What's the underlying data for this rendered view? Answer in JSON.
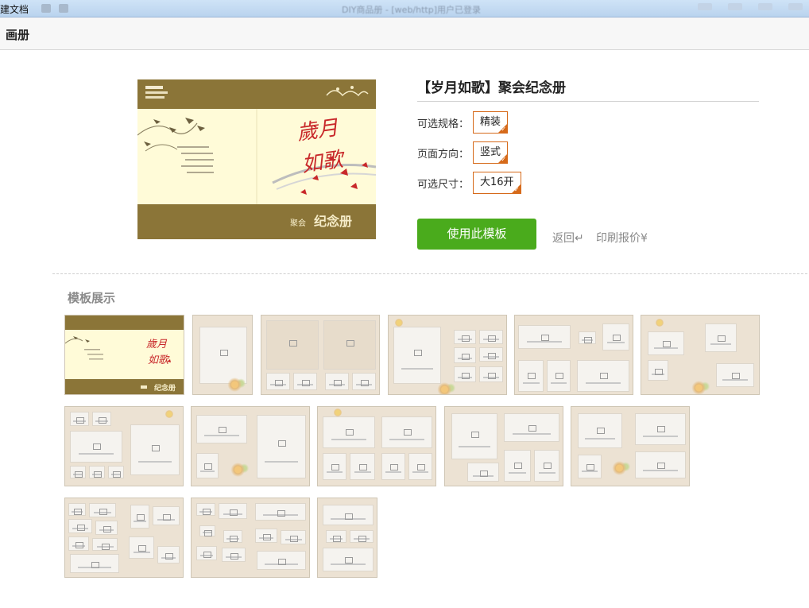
{
  "titlebar": {
    "app_name": "建文档",
    "doc_title": "DIY商品册 - [web/http]用户已登录"
  },
  "appbar": {
    "title": "画册"
  },
  "product": {
    "title": "【岁月如歌】聚会纪念册",
    "options": [
      {
        "label": "可选规格：",
        "value": "精装"
      },
      {
        "label": "页面方向：",
        "value": "竖式"
      },
      {
        "label": "可选尺寸：",
        "value": "大16开"
      }
    ],
    "use_template_label": "使用此模板",
    "back_label": "返回↵",
    "quote_label": "印刷报价¥"
  },
  "cover": {
    "calligraphy": "歲月如歌",
    "subtitle": "聚会",
    "album_text": "纪念册"
  },
  "templates": {
    "section_title": "模板展示",
    "count": 14
  },
  "colors": {
    "cover_brown": "#8b7538",
    "cover_cream": "#fffbd8",
    "accent_orange": "#d66a1a",
    "use_button_green": "#4aab1c"
  }
}
